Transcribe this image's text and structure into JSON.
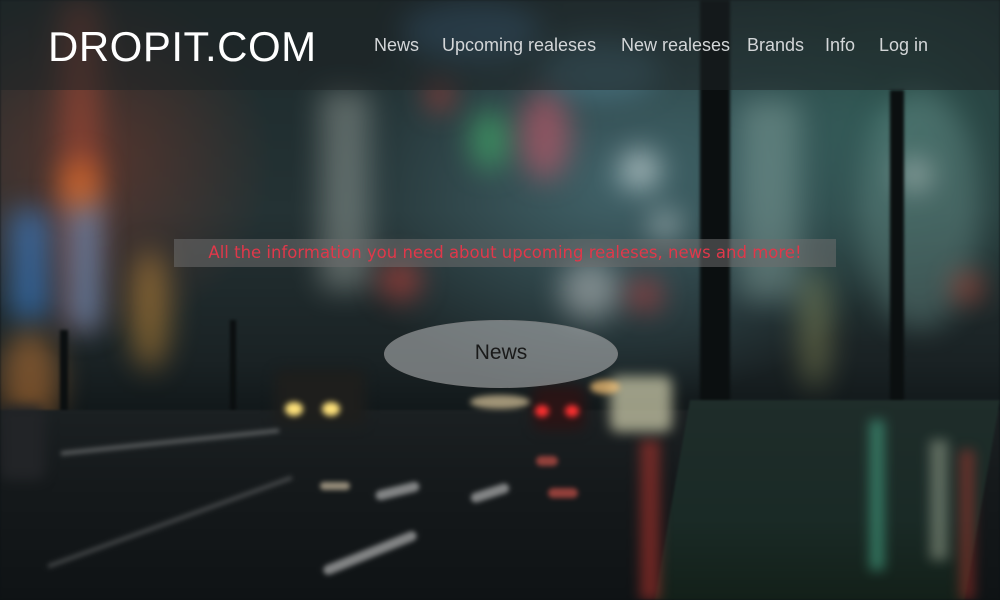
{
  "brand": {
    "logo_text": "DROPIT.COM"
  },
  "nav": {
    "items": [
      {
        "id": "news",
        "label": "News"
      },
      {
        "id": "upcoming",
        "label": "Upcoming realeses"
      },
      {
        "id": "new",
        "label": "New realeses"
      },
      {
        "id": "brands",
        "label": "Brands"
      },
      {
        "id": "info",
        "label": "Info"
      },
      {
        "id": "login",
        "label": "Log in"
      }
    ]
  },
  "hero": {
    "tagline": "All the information you need about upcoming realeses, news and more!",
    "news_button_label": "News"
  },
  "colors": {
    "logo": "#ffffff",
    "nav_text": "#d3d6d8",
    "tagline_text": "#e0384a",
    "tagline_bg": "#6e6e6e",
    "oval_bg": "#aaacae"
  },
  "background": {
    "description_icon": "blurred-city-night-street-image"
  }
}
